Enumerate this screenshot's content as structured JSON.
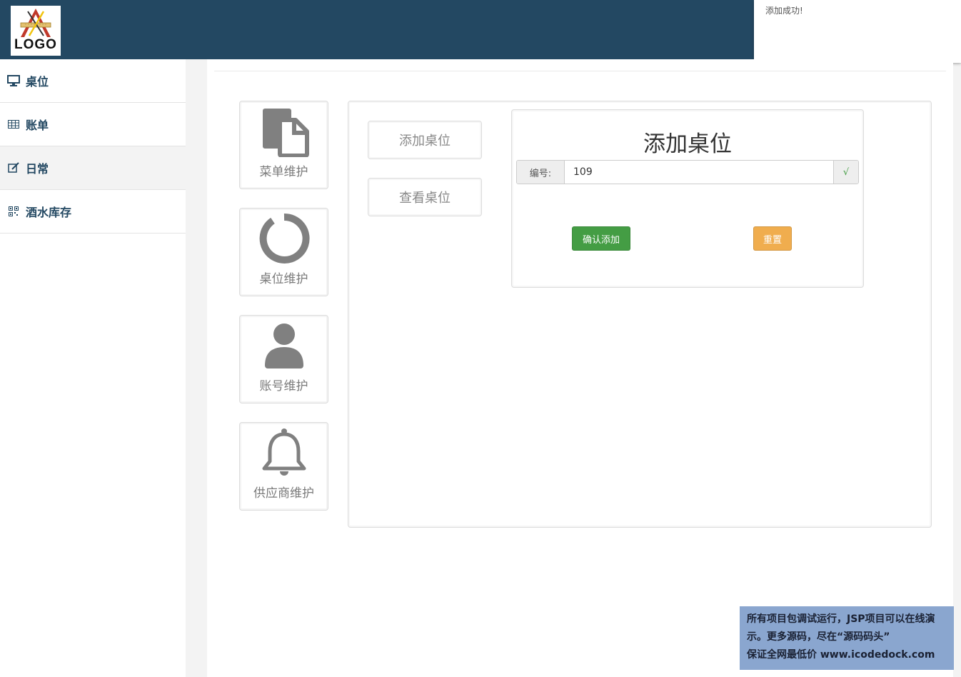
{
  "header": {
    "logo_text": "LOGO"
  },
  "toast": {
    "message": "添加成功!"
  },
  "sidebar": {
    "items": [
      {
        "label": "桌位",
        "icon": "monitor-icon"
      },
      {
        "label": "账单",
        "icon": "table-icon"
      },
      {
        "label": "日常",
        "icon": "edit-icon",
        "active": true
      },
      {
        "label": "酒水库存",
        "icon": "qrcode-icon"
      }
    ]
  },
  "tiles": [
    {
      "label": "菜单维护",
      "icon": "file-copy-icon"
    },
    {
      "label": "桌位维护",
      "icon": "ring-icon"
    },
    {
      "label": "账号维护",
      "icon": "user-icon"
    },
    {
      "label": "供应商维护",
      "icon": "bell-icon"
    }
  ],
  "sub_nav": {
    "add_label": "添加桌位",
    "view_label": "查看桌位"
  },
  "form": {
    "title": "添加桌位",
    "number_label": "编号:",
    "number_value": "109",
    "valid_mark": "√",
    "confirm_label": "确认添加",
    "reset_label": "重置"
  },
  "watermark": {
    "line1": "所有项目包调试运行，JSP项目可以在线演",
    "line2": "示。更多源码，尽在“源码码头”",
    "line3": "保证全网最低价 www.icodedock.com"
  },
  "colors": {
    "header_bg": "#234862",
    "sidebar_text": "#234862",
    "confirm_green": "#449d44",
    "reset_orange": "#f0ad4e",
    "watermark_bg": "#8aa6cf"
  }
}
